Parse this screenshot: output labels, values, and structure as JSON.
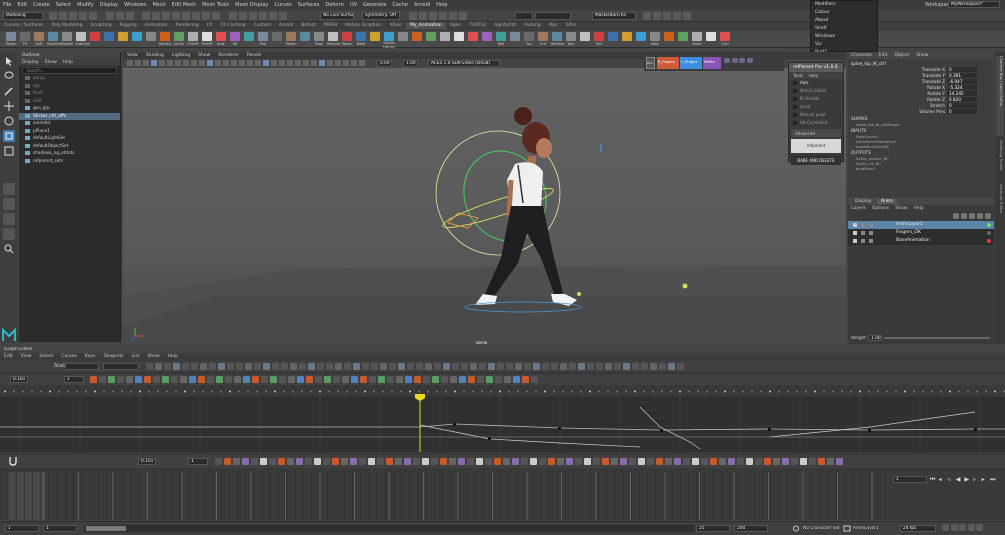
{
  "menubar": {
    "items": [
      "File",
      "Edit",
      "Create",
      "Select",
      "Modify",
      "Display",
      "Windows",
      "Mesh",
      "Edit Mesh",
      "Mesh Tools",
      "Mesh Display",
      "Curves",
      "Surfaces",
      "Deform",
      "UV",
      "Generate",
      "Cache",
      "Arnold",
      "Help"
    ],
    "workspace_label": "Workspace:",
    "workspace_value": "MyWorkspace*"
  },
  "statusline": {
    "mode": "Modeling",
    "surface_dropdown": "No Live Surface",
    "symmetry": "Symmetry: Off",
    "camera_menu": "MasterBarn Ks"
  },
  "shelf_tabs": {
    "items": [
      "Curves / Surfaces",
      "Poly Modeling",
      "Sculpting",
      "Rigging",
      "Animation",
      "Rendering",
      "FX",
      "FX Caching",
      "Custom",
      "Arnold",
      "Bifrost",
      "MASH",
      "Motion Graphics",
      "XGen",
      "My_Animation",
      "Xgen",
      "TURTLE",
      "AgilityCtrl",
      "Autorig",
      "Mpc",
      "Sitcs"
    ],
    "active_index": 14
  },
  "shelf": {
    "labels": [
      "Tween",
      "Plt",
      "ZoD",
      "Poseline",
      "Poselib",
      "Outlined",
      "",
      "",
      "",
      "",
      "",
      "Retract",
      "LocFix",
      "LTShift",
      "SHAPE",
      "dust",
      "Rtl",
      "",
      "Proj",
      "",
      "Tween",
      "",
      "Pose",
      "Rebuild",
      "Tween",
      "Bake",
      "",
      "Studio Library",
      "",
      "",
      "",
      "",
      "",
      "",
      "",
      "Refi",
      "",
      "Iso",
      "Ctrl",
      "Refresh",
      "Key",
      "",
      "Set",
      "",
      "",
      "",
      "eKey",
      "",
      "",
      "Anim",
      "",
      "Outl"
    ]
  },
  "top_popup": {
    "items": [
      "Modifiers",
      "Colour",
      "About",
      "Shelf",
      "Windows",
      "Viz",
      "Butt1",
      "Butt4",
      "Gfind"
    ]
  },
  "outliner": {
    "title": "Outliner",
    "menu": [
      "Display",
      "Show",
      "Help"
    ],
    "search_placeholder": "Search...",
    "rows": [
      {
        "label": "persp",
        "dim": true
      },
      {
        "label": "top",
        "dim": true
      },
      {
        "label": "front",
        "dim": true
      },
      {
        "label": "side",
        "dim": true
      },
      {
        "label": "geo_grp",
        "dim": false
      },
      {
        "label": "Sticker_ctrl_offs",
        "dim": false,
        "selected": true
      },
      {
        "label": "animdot",
        "dim": false
      },
      {
        "label": "pPlane1",
        "dim": false
      },
      {
        "label": "defaultLightSet",
        "dim": false
      },
      {
        "label": "defaultObjectSet",
        "dim": false
      },
      {
        "label": "shadowo_ng_etrlots",
        "dim": false
      },
      {
        "label": "refparent_sets",
        "dim": false
      }
    ]
  },
  "viewport": {
    "menu": [
      "View",
      "Shading",
      "Lighting",
      "Show",
      "Renderer",
      "Panels"
    ],
    "field_a": "0.00",
    "field_b": "1.00",
    "colorspace": "ACES 1.0 SDR-video (sRGB)",
    "camera_label": "persp"
  },
  "pose_buttons": {
    "items": [
      "ALL",
      "R_Fingers",
      "L_Fingers",
      "Reflex"
    ]
  },
  "refparent": {
    "title": "refParent Pro v1.0.0",
    "menu": [
      "Tools",
      "Help"
    ],
    "options": [
      "Axis",
      "Match Global",
      "IK Handle",
      "Local",
      "Manual pivot",
      "Hit Combined"
    ],
    "advanced": "Advanced",
    "button": "refparent",
    "bake_button": "BAKE AND DELETE"
  },
  "channelbox": {
    "tabs": [
      "Channels",
      "Edit",
      "Object",
      "Show"
    ],
    "object_name": "spine_hip_IK_ctrl",
    "attrs": [
      {
        "name": "Translate X",
        "value": "0"
      },
      {
        "name": "Translate Y",
        "value": "0.391"
      },
      {
        "name": "Translate Z",
        "value": "-6.047"
      },
      {
        "name": "Rotate X",
        "value": "-5.324"
      },
      {
        "name": "Rotate Y",
        "value": "14.245"
      },
      {
        "name": "Rotate Z",
        "value": "6.820"
      },
      {
        "name": "Stretch",
        "value": "0"
      },
      {
        "name": "Volume Pres",
        "value": "0"
      }
    ],
    "sections": [
      {
        "title": "SHAPES",
        "items": [
          "spine_hip_IK_ctrlShape"
        ]
      },
      {
        "title": "INPUTS",
        "items": [
          "AnimLayer1",
          "transformGeometry9",
          "makeNurbCircle8"
        ]
      },
      {
        "title": "OUTPUTS",
        "items": [
          "Spine_stretch_BC",
          "Spine_crt_BC",
          "blndPose1"
        ]
      }
    ]
  },
  "layer_editor": {
    "tabs": [
      "Display",
      "Anim"
    ],
    "menu": [
      "Layers",
      "Options",
      "Show",
      "Help"
    ],
    "layers": [
      {
        "name": "AnimLayer1",
        "selected": true
      },
      {
        "name": "Fingers_OK",
        "selected": false
      },
      {
        "name": "BaseAnimation",
        "selected": false
      }
    ],
    "weight_label": "Weight",
    "weight_value": "1.000"
  },
  "side_tabs": [
    "Channel Box / Layer Editor",
    "Modeling Toolkit",
    "Attribute Editor"
  ],
  "graph_editor": {
    "title": "Graph Editor",
    "menu": [
      "Edit",
      "View",
      "Select",
      "Curves",
      "Keys",
      "Tangents",
      "List",
      "Show",
      "Help"
    ],
    "stats_label": "Stats",
    "frame_field": "0.101",
    "value_field": "1",
    "bottom_frame": "0.101",
    "bottom_value": "1"
  },
  "timeline": {
    "current_frame": "1",
    "start_frame": "1",
    "range_start": "1",
    "range_end_a": "25",
    "range_end_b": "200",
    "character_set": "No Character Set",
    "anim_layer": "AnimLayer1",
    "fps": "24 fps"
  }
}
